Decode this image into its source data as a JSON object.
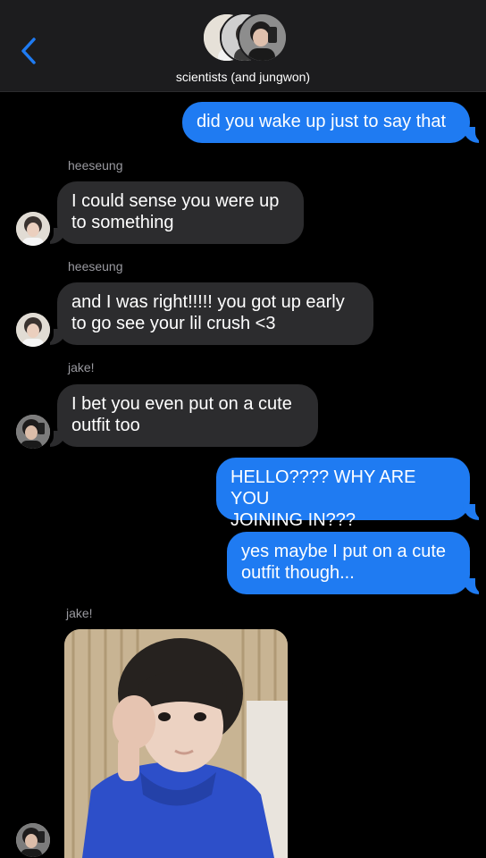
{
  "header": {
    "title": "scientists (and jungwon)",
    "back_icon": "chevron-left-icon",
    "accent": "#1f7bf2"
  },
  "messages": [
    {
      "kind": "out",
      "text": "did you wake up just to say that"
    },
    {
      "kind": "in",
      "sender": "heeseung",
      "text": "I could sense you were up\nto something"
    },
    {
      "kind": "in",
      "sender": "heeseung",
      "text": "and I was right!!!!! you got up early\nto go see your lil crush <3"
    },
    {
      "kind": "in",
      "sender": "jake!",
      "text": "I bet you even put on a cute\noutfit too"
    },
    {
      "kind": "out",
      "text": "HELLO???? WHY ARE YOU\nJOINING IN???"
    },
    {
      "kind": "out",
      "text": "yes maybe I put on a cute\noutfit though..."
    },
    {
      "kind": "in-image",
      "sender": "jake!"
    }
  ],
  "colors": {
    "background": "#000000",
    "incoming_bubble": "#2c2c2e",
    "outgoing_bubble": "#1f7bf2",
    "sender_label": "#9a9aa0"
  }
}
